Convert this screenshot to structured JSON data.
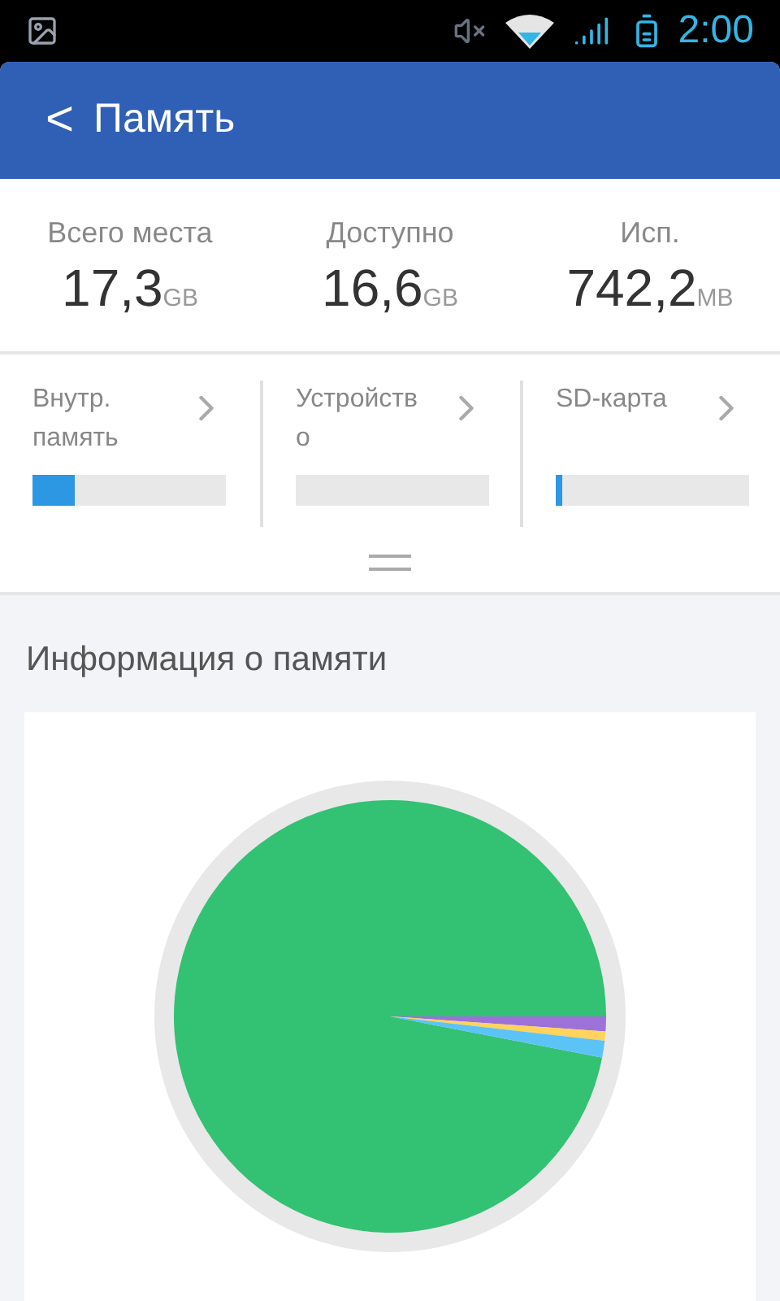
{
  "status_bar": {
    "time": "2:00"
  },
  "header": {
    "back": "<",
    "title": "Память"
  },
  "stats": [
    {
      "label": "Всего места",
      "value": "17,3",
      "unit": "GB"
    },
    {
      "label": "Доступно",
      "value": "16,6",
      "unit": "GB"
    },
    {
      "label": "Исп.",
      "value": "742,2",
      "unit": "MB"
    }
  ],
  "storages": [
    {
      "label": "Внутр. память",
      "level": 0.22
    },
    {
      "label": "Устройство"
    },
    {
      "label": "SD-карта",
      "level": 0.03
    }
  ],
  "section": {
    "title": "Информация о памяти"
  }
}
